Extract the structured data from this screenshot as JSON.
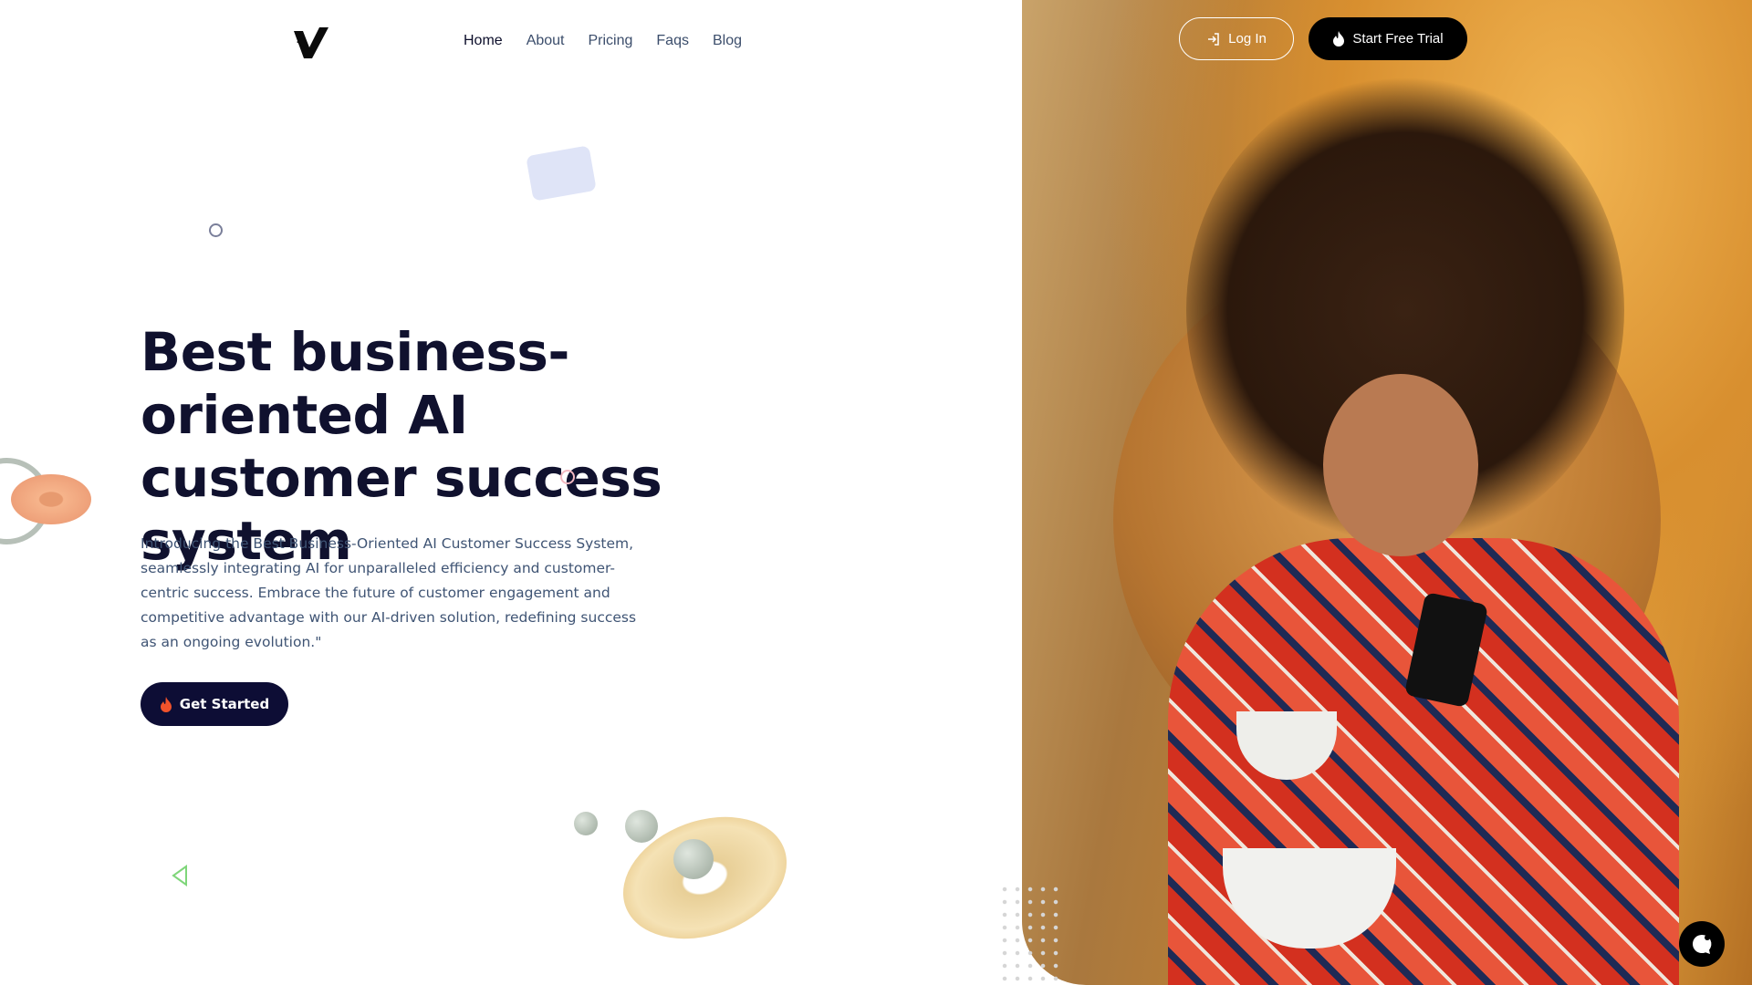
{
  "header": {
    "logo": "V",
    "nav": [
      {
        "label": "Home",
        "active": true
      },
      {
        "label": "About"
      },
      {
        "label": "Pricing"
      },
      {
        "label": "Faqs"
      },
      {
        "label": "Blog"
      }
    ],
    "login_label": "Log In",
    "trial_label": "Start Free Trial"
  },
  "hero": {
    "title": "Best business-oriented AI customer success system",
    "description": "Introducing the Best Business-Oriented AI Customer Success System, seamlessly integrating AI for unparalleled efficiency and customer-centric success. Embrace the future of customer engagement and competitive advantage with our AI-driven solution, redefining success as an ongoing evolution.\"",
    "cta_label": "Get Started"
  },
  "colors": {
    "primary": "#0d0d35",
    "accent_flame": "#f0522b",
    "text": "#10112e",
    "muted": "#3f5474"
  },
  "icons": {
    "login": "login-icon",
    "flame": "flame-icon",
    "chat": "chat-icon"
  }
}
